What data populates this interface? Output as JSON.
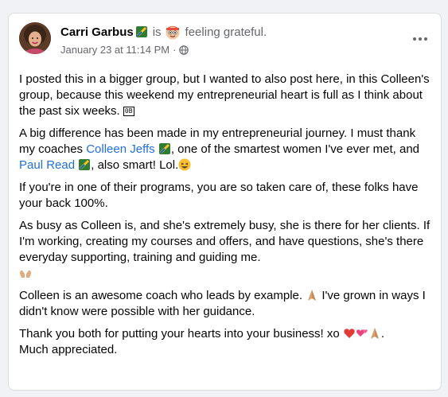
{
  "post": {
    "author": "Carri Garbus",
    "is_text": "is",
    "feeling": "feeling grateful.",
    "timestamp": "January 23 at 11:14 PM",
    "separator": "·",
    "paragraphs": {
      "p1": "I posted this in a bigger group, but I wanted to also post here, in this Colleen's group, because this weekend my entrepreneurial heart is full as I think about the past six weeks.",
      "p1_glyph": "0B",
      "p2a": "A big difference has been made in my entrepreneurial journey. I must thank my coaches ",
      "mention1": "Colleen Jeffs",
      "p2b": ", one of the smartest women I've ever met, and ",
      "mention2": "Paul Read",
      "p2c": ", also smart! Lol.",
      "p3": "If you're in one of their programs, you are so taken care of, these folks have your back 100%.",
      "p4": "As busy as Colleen is, and she's extremely busy, she is there for her clients. If I'm working, creating my courses and offers, and have questions, she's there everyday supporting, training and guiding me.",
      "p5a": "Colleen is an awesome coach who leads by example.",
      "p5b": " I've grown in ways I didn't know were possible with her guidance.",
      "p6a": "Thank you both for putting your hearts into your business! xo ",
      "p6b": "Much appreciated."
    }
  },
  "colors": {
    "page_bg": "#f0f2f5",
    "card_bg": "#ffffff",
    "text": "#050505",
    "secondary_text": "#65676b",
    "link": "#216fdb"
  },
  "icons": {
    "badge": "top-fan-badge-icon",
    "feeling": "feeling-emoji-icon",
    "audience": "globe-icon",
    "more": "more-options-icon",
    "laugh": "laughing-emoji-icon",
    "hands": "open-hands-emoji-icon",
    "pray": "praying-hands-emoji-icon",
    "heart": "red-heart-emoji-icon",
    "hearts": "two-hearts-emoji-icon"
  }
}
